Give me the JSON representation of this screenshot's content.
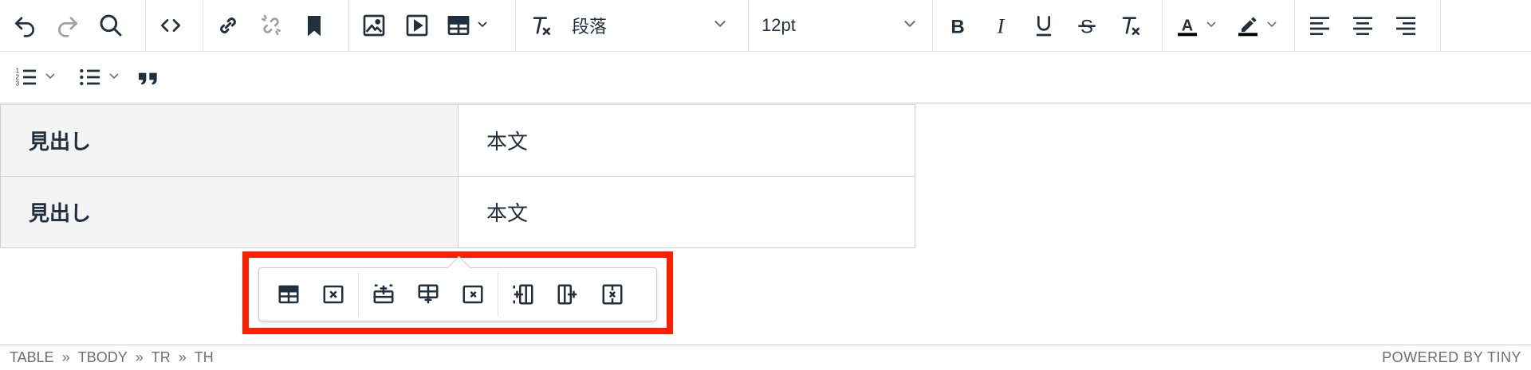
{
  "toolbar": {
    "block_format": "段落",
    "font_size": "12pt",
    "text_color": "#000000",
    "highlight_color": "#000000",
    "icons": {
      "undo": "undo-icon",
      "redo": "redo-icon",
      "find": "search-icon",
      "code": "code-icon",
      "link": "link-icon",
      "unlink": "unlink-icon",
      "bookmark": "bookmark-icon",
      "image": "image-icon",
      "media": "media-icon",
      "table": "table-icon",
      "clear_format": "clear-format-icon",
      "bold": "bold-icon",
      "italic": "italic-icon",
      "underline": "underline-icon",
      "strikethrough": "strikethrough-icon",
      "remove_format": "remove-format-icon",
      "text_color": "text-color-icon",
      "highlight": "highlight-icon",
      "align_left": "align-left-icon",
      "align_center": "align-center-icon",
      "align_right": "align-right-icon",
      "ordered_list": "ordered-list-icon",
      "bullet_list": "bullet-list-icon",
      "blockquote": "blockquote-icon"
    }
  },
  "table": {
    "rows": [
      {
        "heading": "見出し",
        "body": "本文"
      },
      {
        "heading": "見出し",
        "body": "本文"
      }
    ]
  },
  "context_toolbar": {
    "highlight_color": "#ff1e00",
    "buttons": [
      "table-properties-icon",
      "delete-table-icon",
      "insert-row-before-icon",
      "insert-row-after-icon",
      "delete-row-icon",
      "insert-column-before-icon",
      "insert-column-after-icon",
      "delete-column-icon"
    ]
  },
  "statusbar": {
    "path": [
      "TABLE",
      "TBODY",
      "TR",
      "TH"
    ],
    "separator": "»",
    "branding": "POWERED BY TINY"
  }
}
